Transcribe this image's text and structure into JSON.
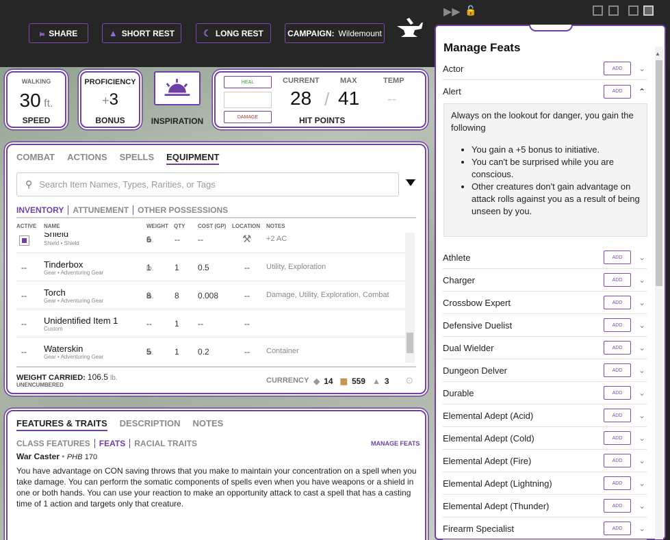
{
  "header": {
    "share": "SHARE",
    "short_rest": "SHORT REST",
    "long_rest": "LONG REST",
    "campaign_label": "CAMPAIGN:",
    "campaign_value": "Wildemount"
  },
  "stats": {
    "walking_label": "WALKING",
    "speed_value": "30",
    "speed_unit": "ft.",
    "speed_label": "SPEED",
    "proficiency_label": "PROFICIENCY",
    "proficiency_sign": "+",
    "proficiency_value": "3",
    "bonus_label": "BONUS",
    "inspiration_label": "INSPIRATION",
    "heal_label": "HEAL",
    "damage_label": "DAMAGE",
    "current_label": "CURRENT",
    "current_value": "28",
    "slash": "/",
    "max_label": "MAX",
    "max_value": "41",
    "temp_label": "TEMP",
    "temp_value": "--",
    "hp_label": "HIT POINTS"
  },
  "equipment": {
    "tabs": [
      "COMBAT",
      "ACTIONS",
      "SPELLS",
      "EQUIPMENT"
    ],
    "search_placeholder": "Search Item Names, Types, Rarities, or Tags",
    "subtabs": [
      "INVENTORY",
      "ATTUNEMENT",
      "OTHER POSSESSIONS"
    ],
    "columns": [
      "ACTIVE",
      "NAME",
      "WEIGHT",
      "QTY",
      "COST (GP)",
      "LOCATION",
      "NOTES"
    ],
    "lb": "lb.",
    "rows": [
      {
        "active": "",
        "name": "Shield",
        "sub": "Shield • Shield",
        "weight": "6",
        "qty": "--",
        "cost": "--",
        "location": "",
        "notes": "+2 AC"
      },
      {
        "active": "--",
        "name": "Tinderbox",
        "sub": "Gear • Adventuring Gear",
        "weight": "1",
        "qty": "1",
        "cost": "0.5",
        "location": "--",
        "notes": "Utility, Exploration"
      },
      {
        "active": "--",
        "name": "Torch",
        "sub": "Gear • Adventuring Gear",
        "weight": "8",
        "qty": "8",
        "cost": "0.008",
        "location": "--",
        "notes": "Damage, Utility, Exploration, Combat"
      },
      {
        "active": "--",
        "name": "Unidentified Item 1",
        "sub": "Custom",
        "weight": "--",
        "qty": "1",
        "cost": "--",
        "location": "--",
        "notes": ""
      },
      {
        "active": "--",
        "name": "Waterskin",
        "sub": "Gear • Adventuring Gear",
        "weight": "5",
        "qty": "1",
        "cost": "0.2",
        "location": "--",
        "notes": "Container"
      }
    ],
    "weight_label": "WEIGHT CARRIED:",
    "weight_value": "106.5",
    "encumbrance": "UNENCUMBERED",
    "currency_label": "CURRENCY",
    "currency_1": "14",
    "currency_2": "559",
    "currency_3": "3"
  },
  "features": {
    "tabs": [
      "FEATURES & TRAITS",
      "DESCRIPTION",
      "NOTES"
    ],
    "subtabs": [
      "CLASS FEATURES",
      "FEATS",
      "RACIAL TRAITS"
    ],
    "manage": "MANAGE FEATS",
    "feat_name": "War Caster",
    "bullet": "•",
    "source": "PHB",
    "page": "170",
    "text": "You have advantage on CON saving throws that you make to maintain your concentration on a spell when you take damage. You can perform the somatic components of spells even when you have weapons or a shield in one or both hands. You can use your reaction to make an opportunity attack to cast a spell that has a casting time of 1 action and targets only that creature."
  },
  "manage_feats": {
    "title": "Manage Feats",
    "add_label": "ADD",
    "alert_desc_intro": "Always on the lookout for danger, you gain the following",
    "alert_bullets": [
      "You gain a +5 bonus to initiative.",
      "You can't be surprised while you are conscious.",
      "Other creatures don't gain advantage on attack rolls against you as a result of being unseen by you."
    ],
    "feats": [
      "Actor",
      "Alert",
      "Athlete",
      "Charger",
      "Crossbow Expert",
      "Defensive Duelist",
      "Dual Wielder",
      "Dungeon Delver",
      "Durable",
      "Elemental Adept (Acid)",
      "Elemental Adept (Cold)",
      "Elemental Adept (Fire)",
      "Elemental Adept (Lightning)",
      "Elemental Adept (Thunder)",
      "Firearm Specialist"
    ]
  },
  "colors": {
    "accent": "#6f3fa6",
    "heal": "#2e9c3a",
    "damage": "#b2353a"
  }
}
